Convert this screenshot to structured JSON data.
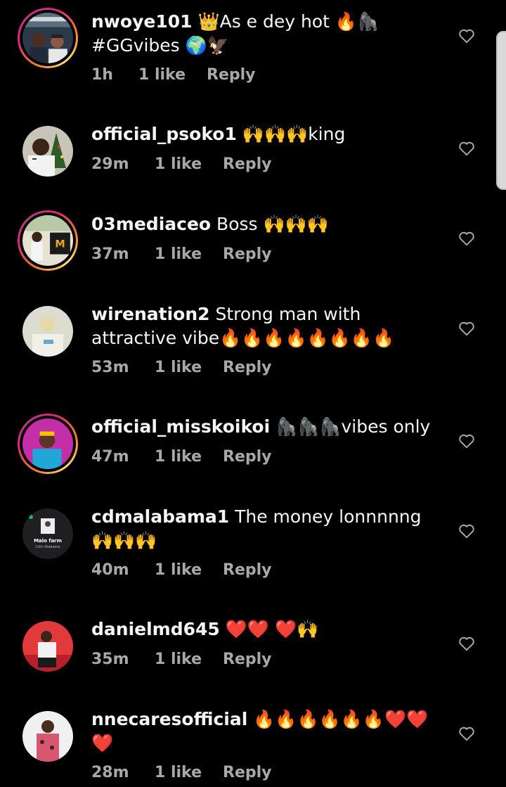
{
  "comments": [
    {
      "username": "nwoye101",
      "text": " 👑As e dey hot 🔥🦍 #GGvibes 🌍🦅",
      "time": "1h",
      "likes": "1 like",
      "reply": "Reply",
      "story_ring": true
    },
    {
      "username": "official_psoko1",
      "text": " 🙌🙌🙌king",
      "time": "29m",
      "likes": "1 like",
      "reply": "Reply",
      "story_ring": false
    },
    {
      "username": "03mediaceo",
      "text": " Boss 🙌🙌🙌",
      "time": "37m",
      "likes": "1 like",
      "reply": "Reply",
      "story_ring": true
    },
    {
      "username": "wirenation2",
      "text": " Strong man with attractive vibe🔥🔥🔥🔥🔥🔥🔥🔥",
      "time": "53m",
      "likes": "1 like",
      "reply": "Reply",
      "story_ring": false
    },
    {
      "username": "official_misskoikoi",
      "text": " 🦍🦍🦍vibes only",
      "time": "47m",
      "likes": "1 like",
      "reply": "Reply",
      "story_ring": true
    },
    {
      "username": "cdmalabama1",
      "text": " The money lonnnnng 🙌🙌🙌",
      "time": "40m",
      "likes": "1 like",
      "reply": "Reply",
      "story_ring": false
    },
    {
      "username": "danielmd645",
      "text": " ❤️❤️ ❤️🙌",
      "time": "35m",
      "likes": "1 like",
      "reply": "Reply",
      "story_ring": false
    },
    {
      "username": "nnecaresofficial",
      "text": " 🔥🔥🔥🔥🔥🔥❤️❤️❤️",
      "time": "28m",
      "likes": "1 like",
      "reply": "Reply",
      "story_ring": false
    }
  ],
  "avatar_video_text": {
    "title": "Malo farm",
    "sub": "Cdm Alabama"
  },
  "icons": {
    "like": "heart-outline-icon"
  },
  "colors": {
    "background": "#000000",
    "text": "#f5f5f5",
    "meta": "#a8a8a8",
    "ring_start": "#f58529",
    "ring_end": "#dd2a7b"
  }
}
